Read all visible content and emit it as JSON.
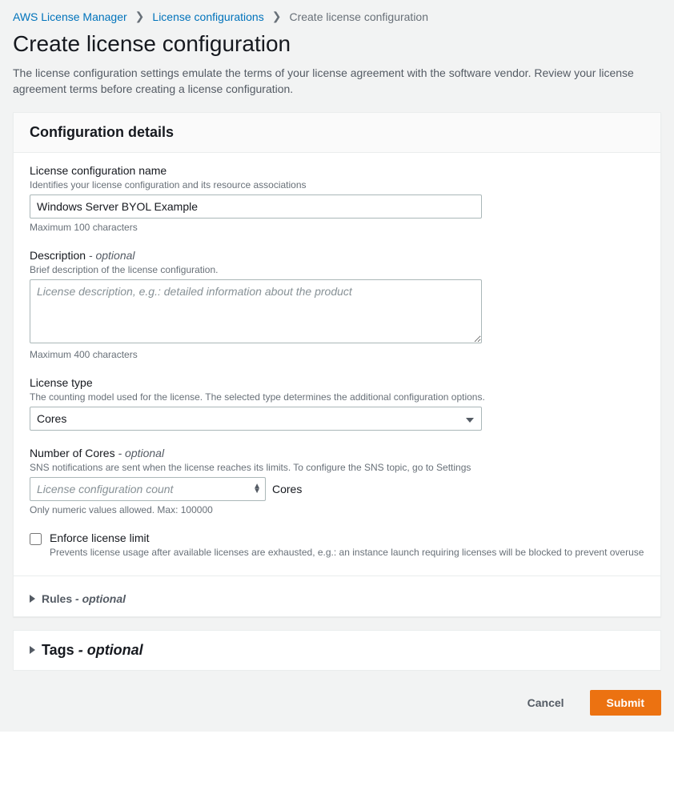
{
  "breadcrumbs": {
    "root": "AWS License Manager",
    "parent": "License configurations",
    "current": "Create license configuration"
  },
  "header": {
    "title": "Create license configuration",
    "description": "The license configuration settings emulate the terms of your license agreement with the software vendor. Review your license agreement terms before creating a license configuration."
  },
  "panel": {
    "title": "Configuration details",
    "name": {
      "label": "License configuration name",
      "hint": "Identifies your license configuration and its resource associations",
      "value": "Windows Server BYOL Example",
      "constraint": "Maximum 100 characters"
    },
    "description": {
      "label": "Description",
      "optional": "- optional",
      "hint": "Brief description of the license configuration.",
      "placeholder": "License description, e.g.: detailed information about the product",
      "constraint": "Maximum 400 characters"
    },
    "license_type": {
      "label": "License type",
      "hint": "The counting model used for the license. The selected type determines the additional configuration options.",
      "selected": "Cores"
    },
    "count": {
      "label": "Number of Cores",
      "optional": "- optional",
      "hint": "SNS notifications are sent when the license reaches its limits. To configure the SNS topic, go to Settings",
      "placeholder": "License configuration count",
      "unit": "Cores",
      "constraint": "Only numeric values allowed. Max: 100000"
    },
    "enforce": {
      "label": "Enforce license limit",
      "hint": "Prevents license usage after available licenses are exhausted, e.g.: an instance launch requiring licenses will be blocked to prevent overuse"
    },
    "rules": {
      "label": "Rules",
      "optional": "- optional"
    }
  },
  "tags": {
    "label": "Tags",
    "optional": "- optional"
  },
  "footer": {
    "cancel": "Cancel",
    "submit": "Submit"
  }
}
